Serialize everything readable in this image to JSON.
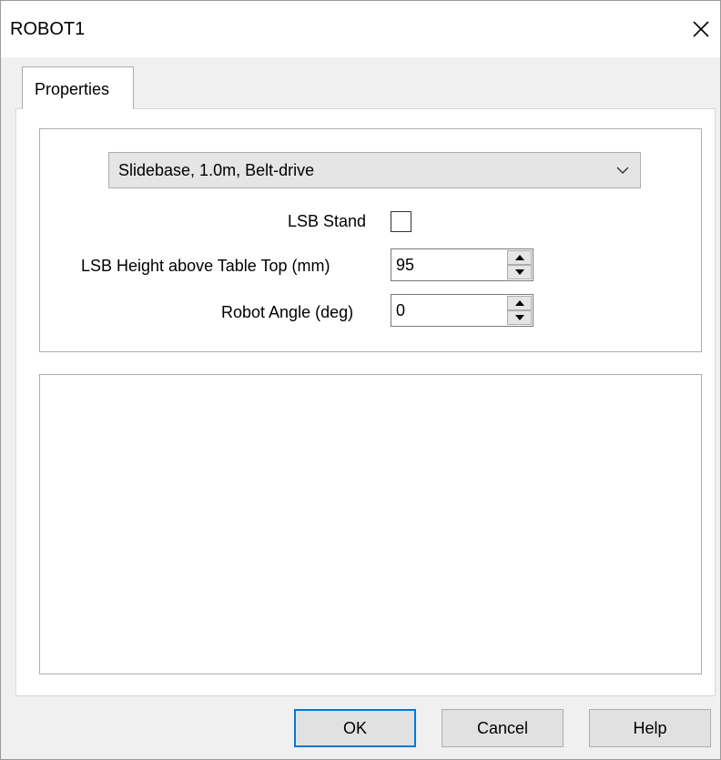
{
  "window": {
    "title": "ROBOT1"
  },
  "tabs": [
    {
      "label": "Properties"
    }
  ],
  "properties": {
    "base_type_combo": {
      "value": "Slidebase, 1.0m, Belt-drive"
    },
    "lsb_stand": {
      "label": "LSB Stand",
      "checked": false
    },
    "lsb_height": {
      "label": "LSB Height above Table Top (mm)",
      "value": "95"
    },
    "robot_angle": {
      "label": "Robot Angle (deg)",
      "value": "0"
    }
  },
  "buttons": {
    "ok": "OK",
    "cancel": "Cancel",
    "help": "Help"
  },
  "icons": {
    "close": "close-icon",
    "combo_arrow": "chevron-down-icon",
    "spin_up": "spin-up-icon",
    "spin_down": "spin-down-icon"
  },
  "colors": {
    "default_button_border": "#0078d7",
    "dialog_background": "#f0f0f0"
  }
}
